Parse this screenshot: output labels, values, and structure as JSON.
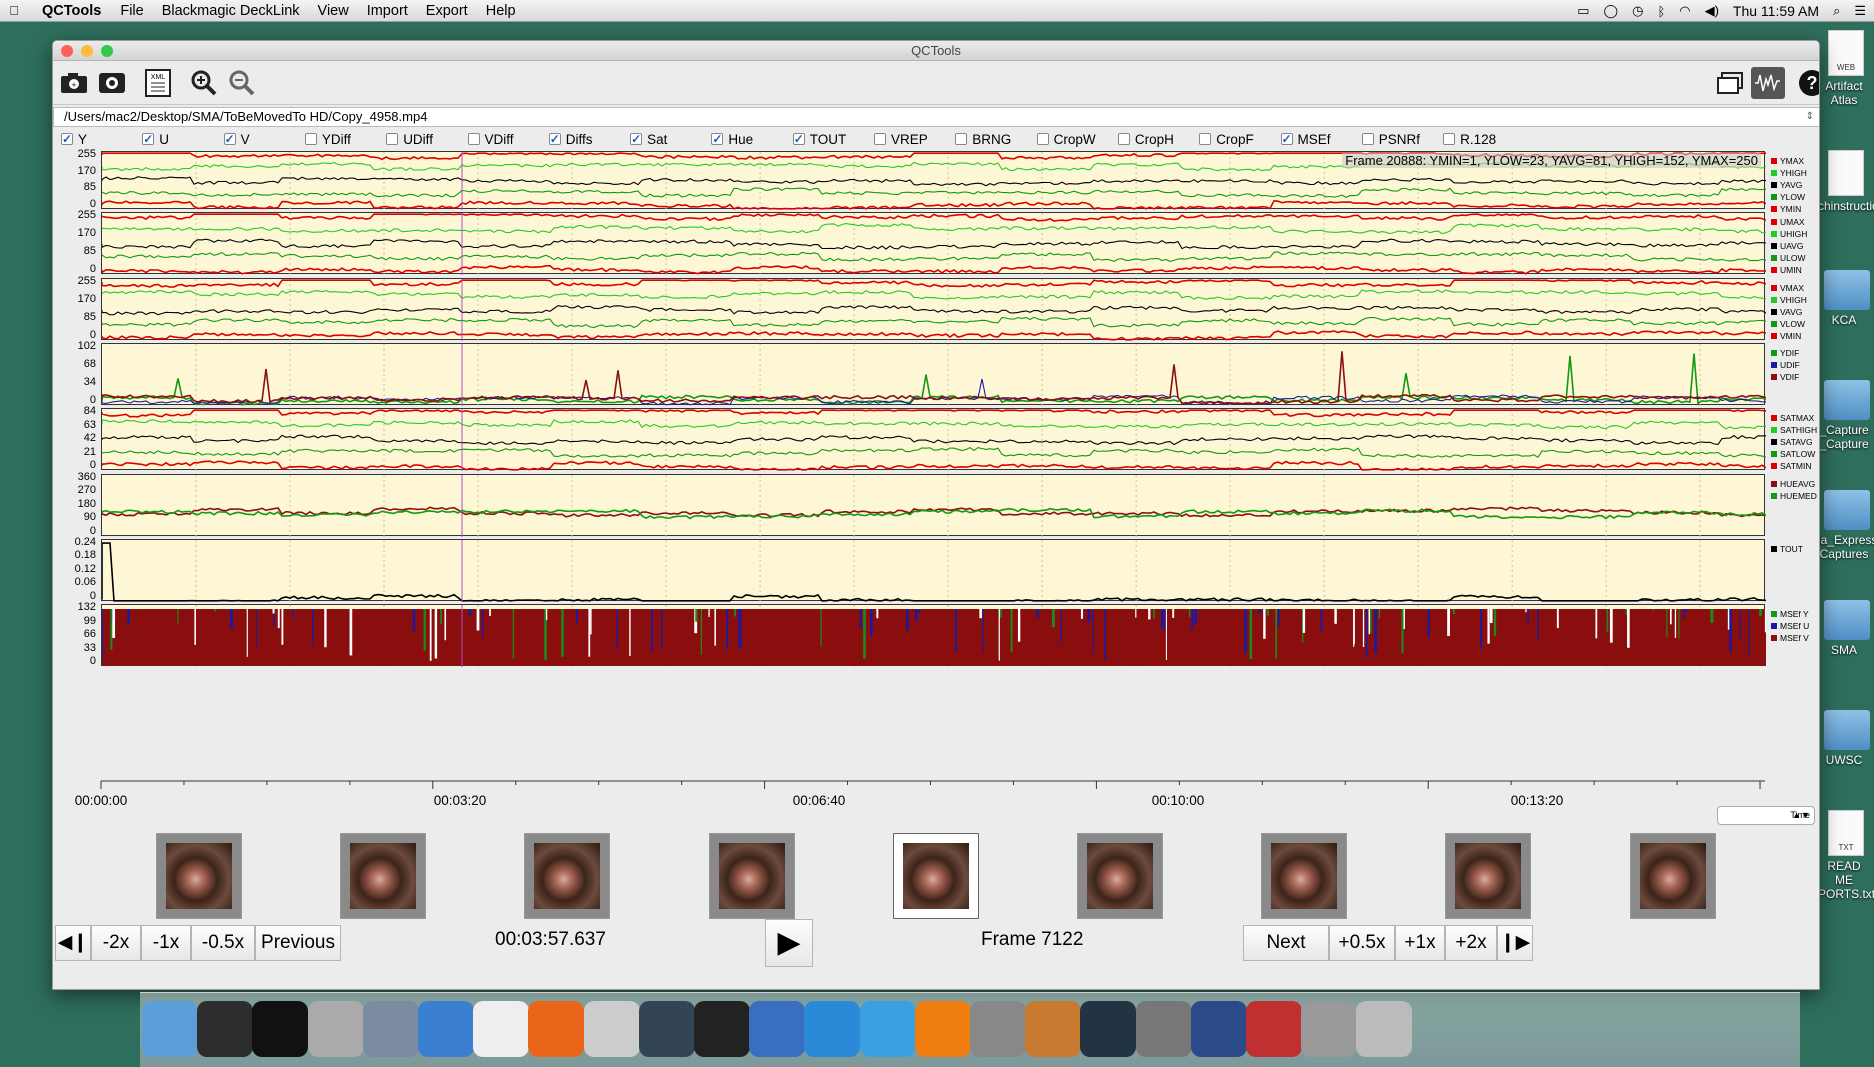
{
  "menubar": {
    "app": "QCTools",
    "items": [
      "File",
      "Blackmagic DeckLink",
      "View",
      "Import",
      "Export",
      "Help"
    ],
    "clock": "Thu 11:59 AM"
  },
  "desktop": [
    "Artifact Atlas",
    "chinstructions",
    "KCA",
    "_Capture _Capture",
    "ia_Express Captures",
    "SMA",
    "UWSC",
    "READ ME PORTS.txt"
  ],
  "window": {
    "title": "QCTools"
  },
  "path": "/Users/mac2/Desktop/SMA/ToBeMovedTo HD/Copy_4958.mp4",
  "filters": [
    {
      "label": "Y",
      "checked": true
    },
    {
      "label": "U",
      "checked": true
    },
    {
      "label": "V",
      "checked": true
    },
    {
      "label": "YDiff",
      "checked": false
    },
    {
      "label": "UDiff",
      "checked": false
    },
    {
      "label": "VDiff",
      "checked": false
    },
    {
      "label": "Diffs",
      "checked": true
    },
    {
      "label": "Sat",
      "checked": true
    },
    {
      "label": "Hue",
      "checked": true
    },
    {
      "label": "TOUT",
      "checked": true
    },
    {
      "label": "VREP",
      "checked": false
    },
    {
      "label": "BRNG",
      "checked": false
    },
    {
      "label": "CropW",
      "checked": false
    },
    {
      "label": "CropH",
      "checked": false
    },
    {
      "label": "CropF",
      "checked": false
    },
    {
      "label": "MSEf",
      "checked": true
    },
    {
      "label": "PSNRf",
      "checked": false
    },
    {
      "label": "R.128",
      "checked": false
    }
  ],
  "frame_info": "Frame 20888: YMIN=1, YLOW=23, YAVG=81, YHIGH=152, YMAX=250",
  "graphs": [
    {
      "ticks": [
        "255",
        "170",
        "85",
        "0"
      ],
      "legend": [
        [
          "YMAX",
          "#d00"
        ],
        [
          "YHIGH",
          "#2c2"
        ],
        [
          "YAVG",
          "#000"
        ],
        [
          "YLOW",
          "#191"
        ],
        [
          "YMIN",
          "#d00"
        ]
      ]
    },
    {
      "ticks": [
        "255",
        "170",
        "85",
        "0"
      ],
      "legend": [
        [
          "UMAX",
          "#d00"
        ],
        [
          "UHIGH",
          "#2c2"
        ],
        [
          "UAVG",
          "#000"
        ],
        [
          "ULOW",
          "#191"
        ],
        [
          "UMIN",
          "#d00"
        ]
      ]
    },
    {
      "ticks": [
        "255",
        "170",
        "85",
        "0"
      ],
      "legend": [
        [
          "VMAX",
          "#d00"
        ],
        [
          "VHIGH",
          "#2c2"
        ],
        [
          "VAVG",
          "#000"
        ],
        [
          "VLOW",
          "#191"
        ],
        [
          "VMIN",
          "#d00"
        ]
      ]
    },
    {
      "ticks": [
        "102",
        "68",
        "34",
        "0"
      ],
      "legend": [
        [
          "YDIF",
          "#191"
        ],
        [
          "UDIF",
          "#1a1aa0"
        ],
        [
          "VDIF",
          "#8b1010"
        ]
      ]
    },
    {
      "ticks": [
        "84",
        "63",
        "42",
        "21",
        "0"
      ],
      "legend": [
        [
          "SATMAX",
          "#d00"
        ],
        [
          "SATHIGH",
          "#2c2"
        ],
        [
          "SATAVG",
          "#000"
        ],
        [
          "SATLOW",
          "#191"
        ],
        [
          "SATMIN",
          "#d00"
        ]
      ]
    },
    {
      "ticks": [
        "360",
        "270",
        "180",
        "90",
        "0"
      ],
      "legend": [
        [
          "HUEAVG",
          "#8b1010"
        ],
        [
          "HUEMED",
          "#191"
        ]
      ]
    },
    {
      "ticks": [
        "0.24",
        "0.18",
        "0.12",
        "0.06",
        "0"
      ],
      "legend": [
        [
          "TOUT",
          "#000"
        ]
      ]
    },
    {
      "ticks": [
        "132",
        "99",
        "66",
        "33",
        "0"
      ],
      "legend": [
        [
          "MSEf Y",
          "#191"
        ],
        [
          "MSEf U",
          "#1a1aa0"
        ],
        [
          "MSEf V",
          "#8b1010"
        ]
      ]
    }
  ],
  "time_labels": [
    "00:00:00",
    "00:03:20",
    "00:06:40",
    "00:10:00",
    "00:13:20"
  ],
  "time_select": "Time",
  "controls": {
    "prev_frame": "◀❙",
    "m2x": "-2x",
    "m1x": "-1x",
    "m05x": "-0.5x",
    "previous": "Previous",
    "timecode": "00:03:57.637",
    "frame": "Frame 7122",
    "next": "Next",
    "p05x": "+0.5x",
    "p1x": "+1x",
    "p2x": "+2x",
    "next_frame": "❙▶"
  },
  "dock": [
    "Finder",
    "Activity Monitor",
    "Terminal",
    "Disk Utility",
    "Launchpad",
    "Safari",
    "TextEdit",
    "Firefox",
    "QCTools",
    "Mission Control",
    "Final Cut",
    "QuickTime",
    "QuickTime X",
    "Xcode",
    "VLC",
    "System Preferences",
    "Mail",
    "Stopwatch",
    "DVD Player",
    "Photo Booth",
    "Script Editor",
    "Utility",
    "Trash"
  ]
}
